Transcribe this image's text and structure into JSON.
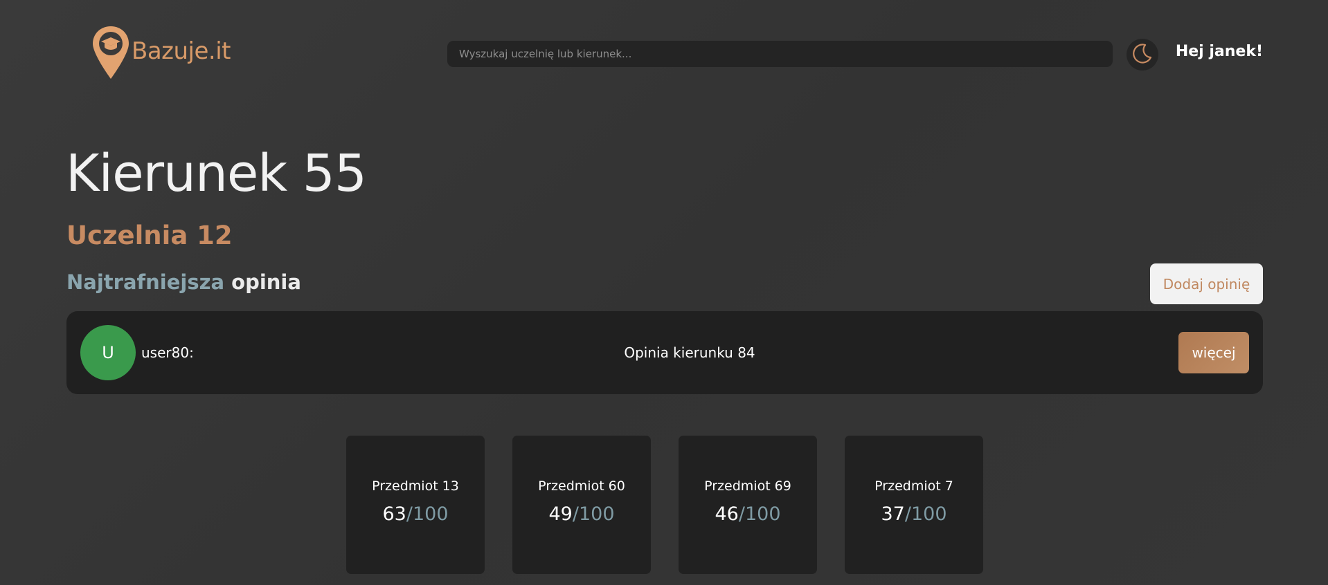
{
  "header": {
    "logo_text": "Bazuje.it",
    "search_placeholder": "Wyszukaj uczelnię lub kierunek...",
    "theme_icon": "moon-icon",
    "greeting": "Hej janek!"
  },
  "course": {
    "title": "Kierunek 55",
    "university": "Uczelnia 12"
  },
  "opinion_section": {
    "heading_accent": "Najtrafniejsza",
    "heading_rest": " opinia",
    "add_button_label": "Dodaj opinię"
  },
  "top_opinion": {
    "avatar_letter": "U",
    "avatar_color": "#3a9a4c",
    "username": "user80:",
    "text": "Opinia kierunku 84",
    "more_label": "więcej"
  },
  "subjects": [
    {
      "name": "Przedmiot 13",
      "score": "63",
      "max": "/100"
    },
    {
      "name": "Przedmiot 60",
      "score": "49",
      "max": "/100"
    },
    {
      "name": "Przedmiot 69",
      "score": "46",
      "max": "/100"
    },
    {
      "name": "Przedmiot 7",
      "score": "37",
      "max": "/100"
    }
  ],
  "colors": {
    "accent": "#d89a68",
    "background": "#353535",
    "card": "#202020",
    "muted_blue": "#8aa5ae"
  }
}
